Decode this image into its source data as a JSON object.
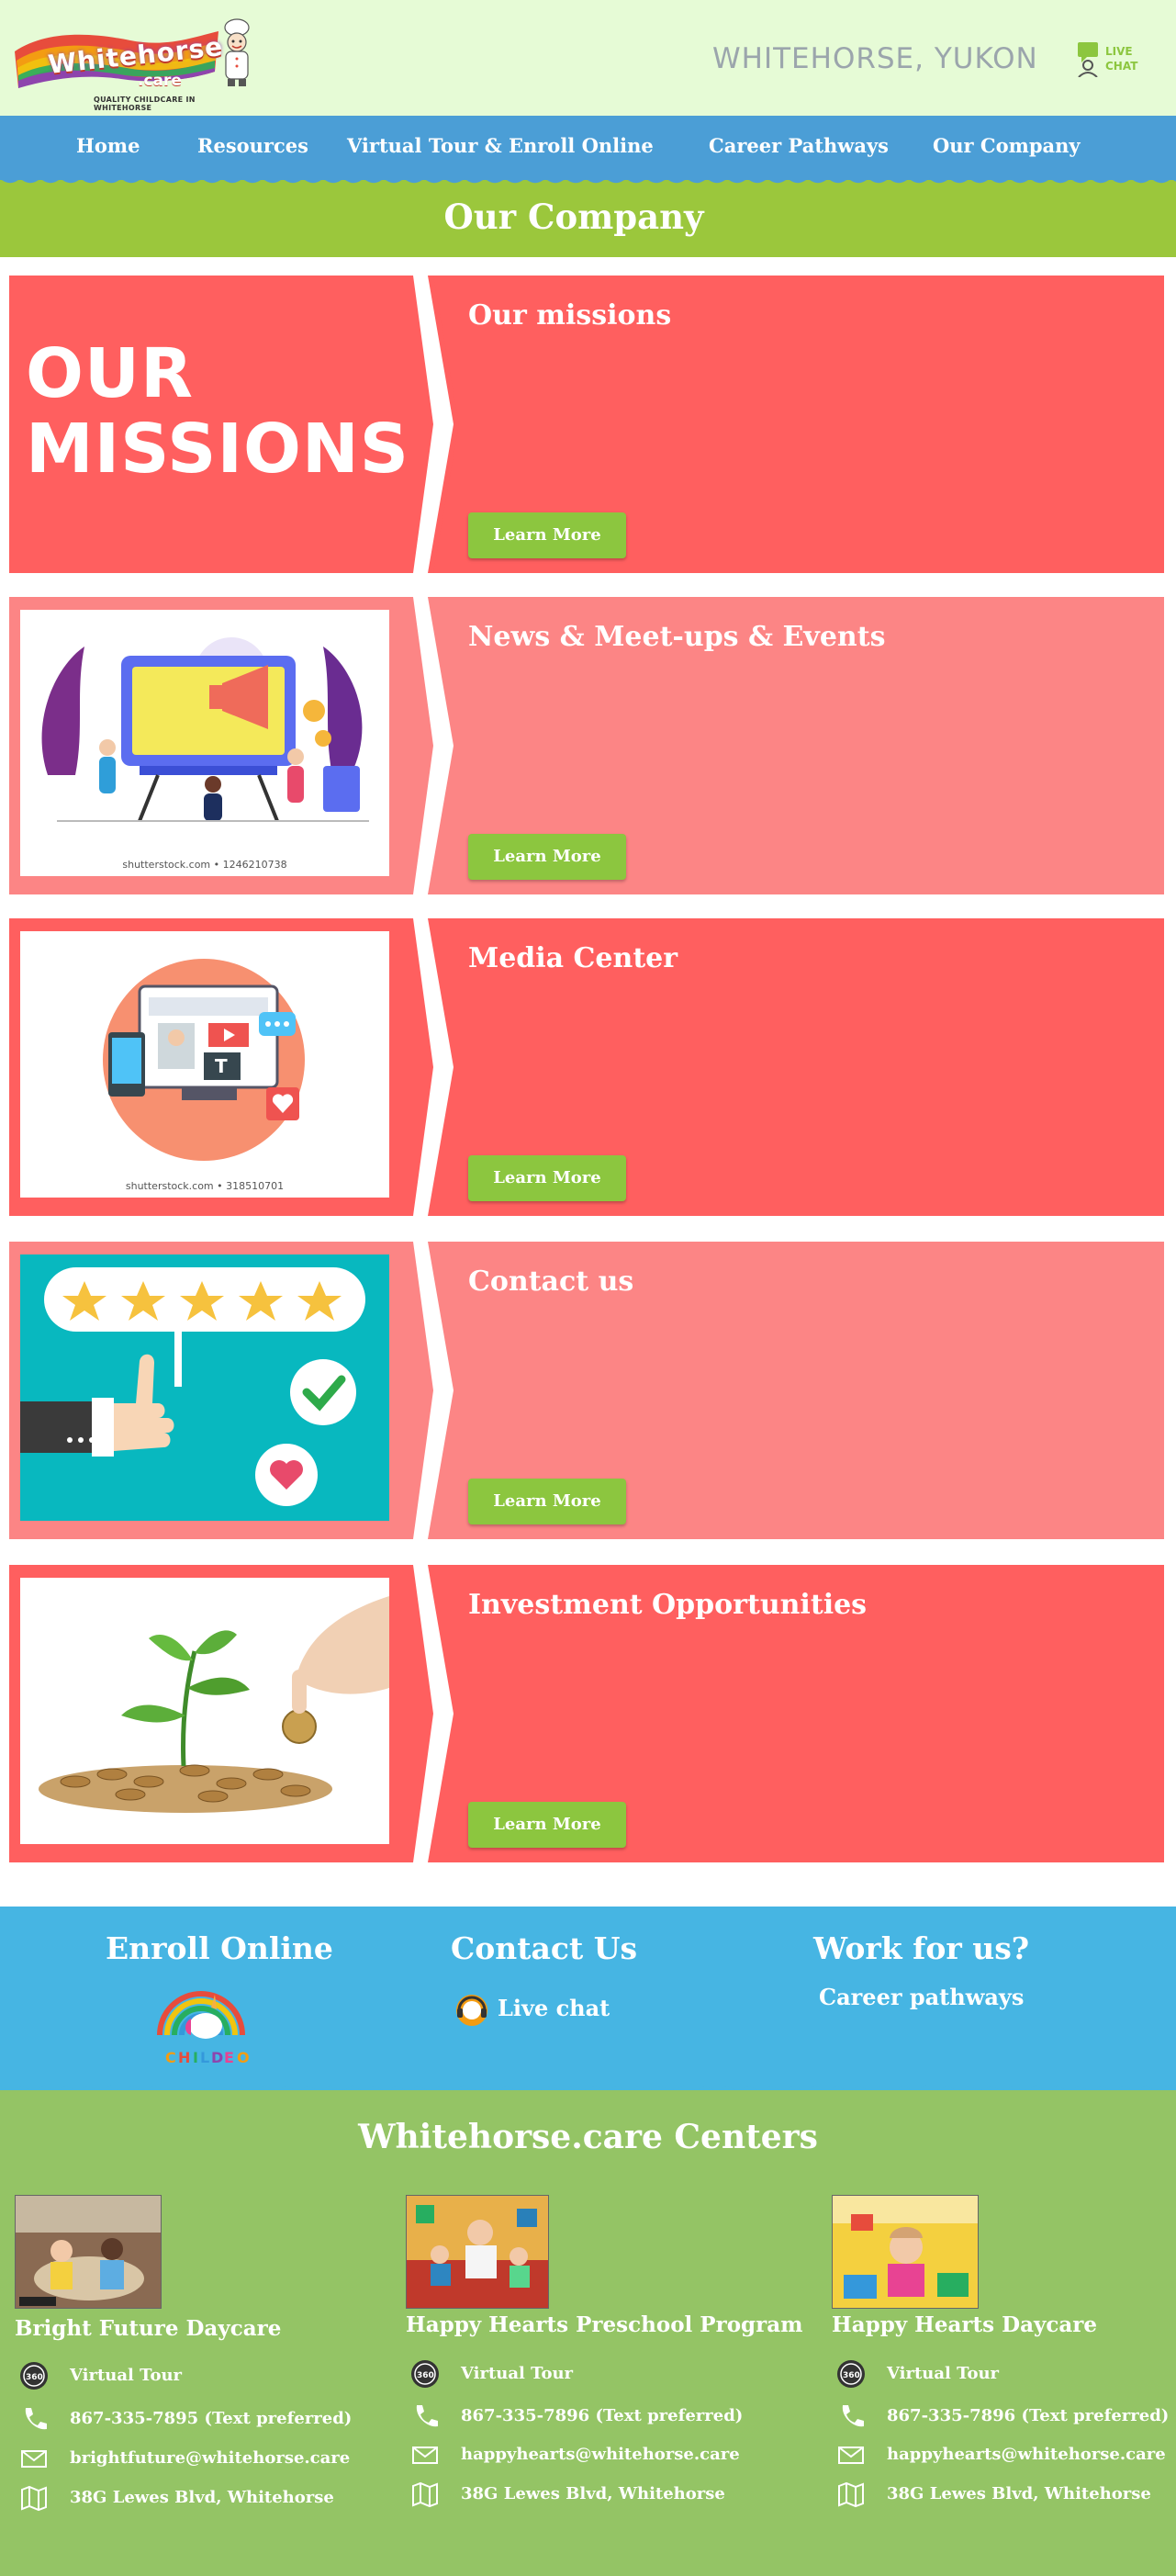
{
  "header": {
    "logo_text": "Whitehorse",
    "logo_suffix": ".care",
    "logo_tagline": "QUALITY CHILDCARE IN WHITEHORSE",
    "location": "WHITEHORSE, YUKON",
    "live_chat": [
      "LIVE",
      "CHAT"
    ]
  },
  "nav": {
    "items": [
      "Home",
      "Resources",
      "Virtual Tour & Enroll Online",
      "Career Pathways",
      "Our Company"
    ]
  },
  "page_title": "Our Company",
  "cards": [
    {
      "title": "Our missions",
      "button": "Learn More",
      "big_text": [
        "OUR",
        "MISSIONS"
      ]
    },
    {
      "title": "News & Meet-ups & Events",
      "button": "Learn More",
      "credit": "shutterstock.com • 1246210738"
    },
    {
      "title": "Media Center",
      "button": "Learn More",
      "credit": "shutterstock.com • 318510701"
    },
    {
      "title": "Contact us",
      "button": "Learn More"
    },
    {
      "title": "Investment Opportunities",
      "button": "Learn More"
    }
  ],
  "footer": {
    "enroll_title": "Enroll Online",
    "contact_title": "Contact Us",
    "live_chat_label": "Live chat",
    "work_title": "Work for us?",
    "career_label": "Career pathways",
    "centers_title": "Whitehorse.care Centers",
    "centers": [
      {
        "name": "Bright Future Daycare",
        "tour": "Virtual Tour",
        "phone": "867-335-7895 (Text preferred)",
        "email": "brightfuture@whitehorse.care",
        "address": "38G Lewes Blvd, Whitehorse"
      },
      {
        "name": "Happy Hearts Preschool Program",
        "tour": "Virtual Tour",
        "phone": "867-335-7896 (Text preferred)",
        "email": "happyhearts@whitehorse.care",
        "address": "38G Lewes Blvd, Whitehorse"
      },
      {
        "name": "Happy Hearts Daycare",
        "tour": "Virtual Tour",
        "phone": "867-335-7896 (Text preferred)",
        "email": "happyhearts@whitehorse.care",
        "address": "38G Lewes Blvd, Whitehorse"
      }
    ]
  },
  "colors": {
    "header_bg": "#e6fbd6",
    "nav_bg": "#4b9ed6",
    "title_band": "#9bc73c",
    "card_dark": "#ff5f5f",
    "card_light": "#fc8585",
    "button": "#8cc63f",
    "footer_blue": "#46b5e3",
    "footer_green": "#94c465"
  }
}
